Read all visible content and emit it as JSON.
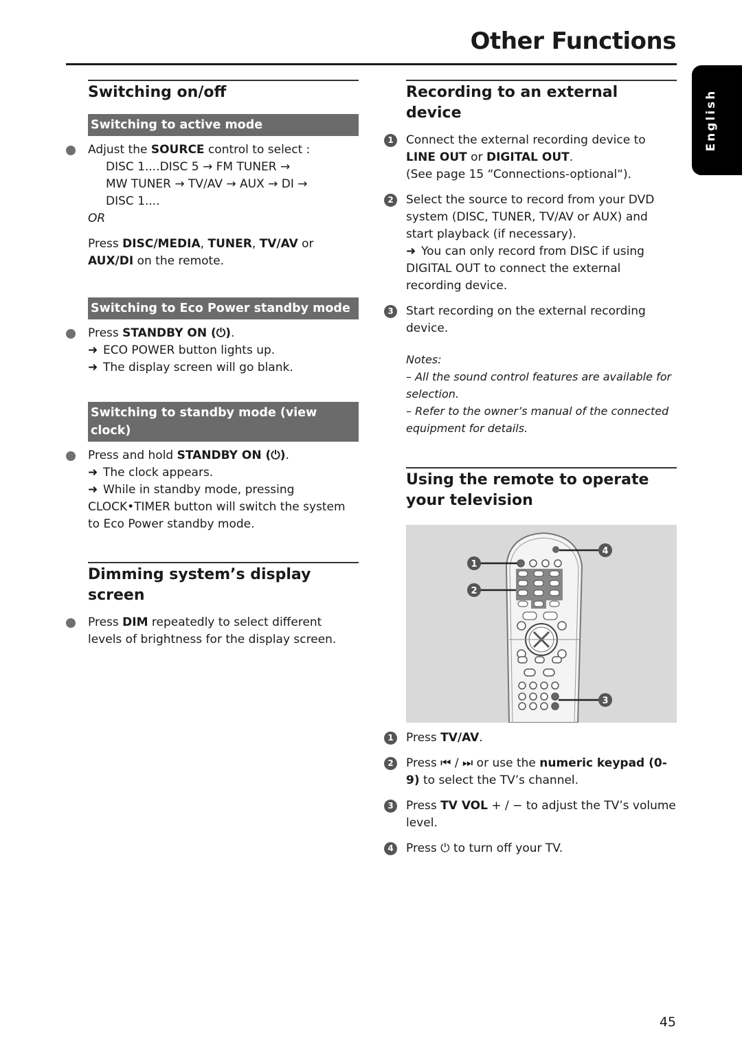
{
  "header": {
    "title": "Other Functions",
    "language_tab": "English",
    "page_number": "45"
  },
  "left": {
    "switching": {
      "title": "Switching on/off",
      "active": {
        "title": "Switching to active mode",
        "line1_pre": "Adjust the ",
        "line1_bold": "SOURCE",
        "line1_post": " control to select :",
        "seq1": "DISC 1....DISC 5 → FM TUNER →",
        "seq2": "MW TUNER → TV/AV → AUX → DI →",
        "seq3": "DISC 1....",
        "or": "OR",
        "press_pre": "Press ",
        "b1": "DISC/MEDIA",
        "s1": ", ",
        "b2": "TUNER",
        "s2": ", ",
        "b3": "TV/AV",
        "s3": " or",
        "b4": "AUX/DI",
        "s4": " on the remote."
      },
      "eco": {
        "title": "Switching to Eco Power standby mode",
        "press_pre": "Press ",
        "press_bold": "STANDBY ON (⏻)",
        "press_post": ".",
        "r1": "ECO POWER button lights up.",
        "r2": "The display screen will go blank."
      },
      "standby": {
        "title": "Switching to standby mode (view clock)",
        "press_pre": "Press and hold ",
        "press_bold": "STANDBY ON (⏻)",
        "press_post": ".",
        "r1": "The clock appears.",
        "r2": "While in standby mode, pressing",
        "r2b": "CLOCK•TIMER button will switch the system to Eco Power standby mode."
      }
    },
    "dimming": {
      "title": "Dimming system’s display screen",
      "pre": "Press ",
      "bold": "DIM",
      "post": " repeatedly to select different levels of brightness for the display screen."
    }
  },
  "right": {
    "recording": {
      "title": "Recording to an external device",
      "steps": [
        {
          "n": "1",
          "pre": "Connect the external recording device to",
          "b1": "LINE OUT",
          "mid": " or ",
          "b2": "DIGITAL OUT",
          "end": ".",
          "note": "(See page 15 “Connections-optional“)."
        },
        {
          "n": "2",
          "text": "Select the source to record from your DVD system (DISC, TUNER, TV/AV or AUX) and start playback (if necessary).",
          "result": "You can only record from DISC if using DIGITAL OUT to connect the external recording device."
        },
        {
          "n": "3",
          "text": "Start recording on the external recording device."
        }
      ],
      "notes_label": "Notes:",
      "notes": [
        "–  All the sound control features are available for selection.",
        "–  Refer to the owner’s manual of the connected equipment for details."
      ]
    },
    "remote": {
      "title": "Using the remote to operate your television",
      "callouts": [
        "1",
        "2",
        "3",
        "4"
      ],
      "steps": [
        {
          "n": "1",
          "pre": "Press ",
          "bold": "TV/AV",
          "post": "."
        },
        {
          "n": "2",
          "pre": "Press ⏮ / ⏭ or use the ",
          "bold": "numeric keypad (0-9)",
          "post": " to select the TV’s channel."
        },
        {
          "n": "3",
          "pre": "Press ",
          "bold": "TV VOL",
          "post": " + / −  to adjust the TV’s volume level."
        },
        {
          "n": "4",
          "pre": "Press ⏻ to turn off your TV.",
          "bold": "",
          "post": ""
        }
      ]
    }
  },
  "colors": {
    "subhead_bg": "#6b6b6b",
    "remote_bg": "#d9d9d9",
    "tab_bg": "#000000"
  }
}
